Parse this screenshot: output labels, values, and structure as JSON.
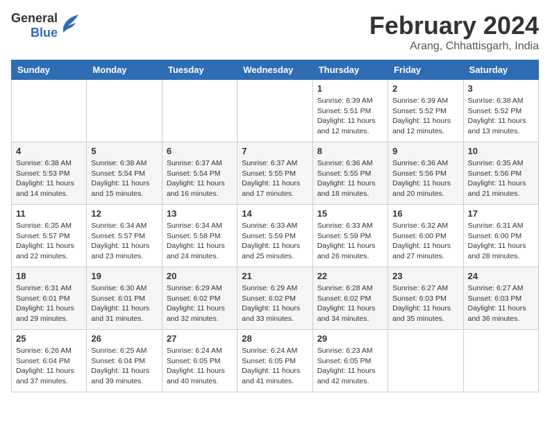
{
  "header": {
    "logo_general": "General",
    "logo_blue": "Blue",
    "month_title": "February 2024",
    "location": "Arang, Chhattisgarh, India"
  },
  "days_of_week": [
    "Sunday",
    "Monday",
    "Tuesday",
    "Wednesday",
    "Thursday",
    "Friday",
    "Saturday"
  ],
  "weeks": [
    [
      {
        "day": "",
        "sunrise": "",
        "sunset": "",
        "daylight": ""
      },
      {
        "day": "",
        "sunrise": "",
        "sunset": "",
        "daylight": ""
      },
      {
        "day": "",
        "sunrise": "",
        "sunset": "",
        "daylight": ""
      },
      {
        "day": "",
        "sunrise": "",
        "sunset": "",
        "daylight": ""
      },
      {
        "day": "1",
        "sunrise": "6:39 AM",
        "sunset": "5:51 PM",
        "daylight": "11 hours and 12 minutes."
      },
      {
        "day": "2",
        "sunrise": "6:39 AM",
        "sunset": "5:52 PM",
        "daylight": "11 hours and 12 minutes."
      },
      {
        "day": "3",
        "sunrise": "6:38 AM",
        "sunset": "5:52 PM",
        "daylight": "11 hours and 13 minutes."
      }
    ],
    [
      {
        "day": "4",
        "sunrise": "6:38 AM",
        "sunset": "5:53 PM",
        "daylight": "11 hours and 14 minutes."
      },
      {
        "day": "5",
        "sunrise": "6:38 AM",
        "sunset": "5:54 PM",
        "daylight": "11 hours and 15 minutes."
      },
      {
        "day": "6",
        "sunrise": "6:37 AM",
        "sunset": "5:54 PM",
        "daylight": "11 hours and 16 minutes."
      },
      {
        "day": "7",
        "sunrise": "6:37 AM",
        "sunset": "5:55 PM",
        "daylight": "11 hours and 17 minutes."
      },
      {
        "day": "8",
        "sunrise": "6:36 AM",
        "sunset": "5:55 PM",
        "daylight": "11 hours and 18 minutes."
      },
      {
        "day": "9",
        "sunrise": "6:36 AM",
        "sunset": "5:56 PM",
        "daylight": "11 hours and 20 minutes."
      },
      {
        "day": "10",
        "sunrise": "6:35 AM",
        "sunset": "5:56 PM",
        "daylight": "11 hours and 21 minutes."
      }
    ],
    [
      {
        "day": "11",
        "sunrise": "6:35 AM",
        "sunset": "5:57 PM",
        "daylight": "11 hours and 22 minutes."
      },
      {
        "day": "12",
        "sunrise": "6:34 AM",
        "sunset": "5:57 PM",
        "daylight": "11 hours and 23 minutes."
      },
      {
        "day": "13",
        "sunrise": "6:34 AM",
        "sunset": "5:58 PM",
        "daylight": "11 hours and 24 minutes."
      },
      {
        "day": "14",
        "sunrise": "6:33 AM",
        "sunset": "5:59 PM",
        "daylight": "11 hours and 25 minutes."
      },
      {
        "day": "15",
        "sunrise": "6:33 AM",
        "sunset": "5:59 PM",
        "daylight": "11 hours and 26 minutes."
      },
      {
        "day": "16",
        "sunrise": "6:32 AM",
        "sunset": "6:00 PM",
        "daylight": "11 hours and 27 minutes."
      },
      {
        "day": "17",
        "sunrise": "6:31 AM",
        "sunset": "6:00 PM",
        "daylight": "11 hours and 28 minutes."
      }
    ],
    [
      {
        "day": "18",
        "sunrise": "6:31 AM",
        "sunset": "6:01 PM",
        "daylight": "11 hours and 29 minutes."
      },
      {
        "day": "19",
        "sunrise": "6:30 AM",
        "sunset": "6:01 PM",
        "daylight": "11 hours and 31 minutes."
      },
      {
        "day": "20",
        "sunrise": "6:29 AM",
        "sunset": "6:02 PM",
        "daylight": "11 hours and 32 minutes."
      },
      {
        "day": "21",
        "sunrise": "6:29 AM",
        "sunset": "6:02 PM",
        "daylight": "11 hours and 33 minutes."
      },
      {
        "day": "22",
        "sunrise": "6:28 AM",
        "sunset": "6:02 PM",
        "daylight": "11 hours and 34 minutes."
      },
      {
        "day": "23",
        "sunrise": "6:27 AM",
        "sunset": "6:03 PM",
        "daylight": "11 hours and 35 minutes."
      },
      {
        "day": "24",
        "sunrise": "6:27 AM",
        "sunset": "6:03 PM",
        "daylight": "11 hours and 36 minutes."
      }
    ],
    [
      {
        "day": "25",
        "sunrise": "6:26 AM",
        "sunset": "6:04 PM",
        "daylight": "11 hours and 37 minutes."
      },
      {
        "day": "26",
        "sunrise": "6:25 AM",
        "sunset": "6:04 PM",
        "daylight": "11 hours and 39 minutes."
      },
      {
        "day": "27",
        "sunrise": "6:24 AM",
        "sunset": "6:05 PM",
        "daylight": "11 hours and 40 minutes."
      },
      {
        "day": "28",
        "sunrise": "6:24 AM",
        "sunset": "6:05 PM",
        "daylight": "11 hours and 41 minutes."
      },
      {
        "day": "29",
        "sunrise": "6:23 AM",
        "sunset": "6:05 PM",
        "daylight": "11 hours and 42 minutes."
      },
      {
        "day": "",
        "sunrise": "",
        "sunset": "",
        "daylight": ""
      },
      {
        "day": "",
        "sunrise": "",
        "sunset": "",
        "daylight": ""
      }
    ]
  ]
}
